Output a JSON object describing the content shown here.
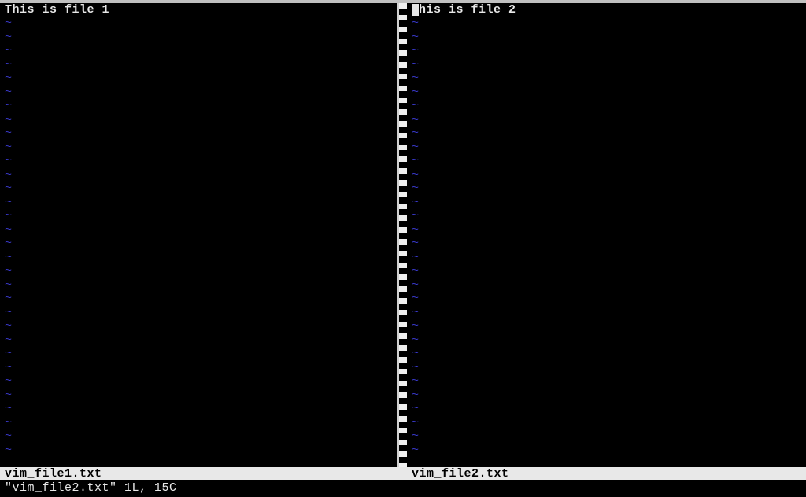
{
  "panes": {
    "left": {
      "content": "This is file 1",
      "tilde": "~",
      "tilde_count": 32,
      "status_filename": "vim_file1.txt"
    },
    "right": {
      "content": "This is file 2",
      "tilde": "~",
      "tilde_count": 32,
      "status_filename": "vim_file2.txt"
    }
  },
  "command_line": "\"vim_file2.txt\" 1L, 15C"
}
